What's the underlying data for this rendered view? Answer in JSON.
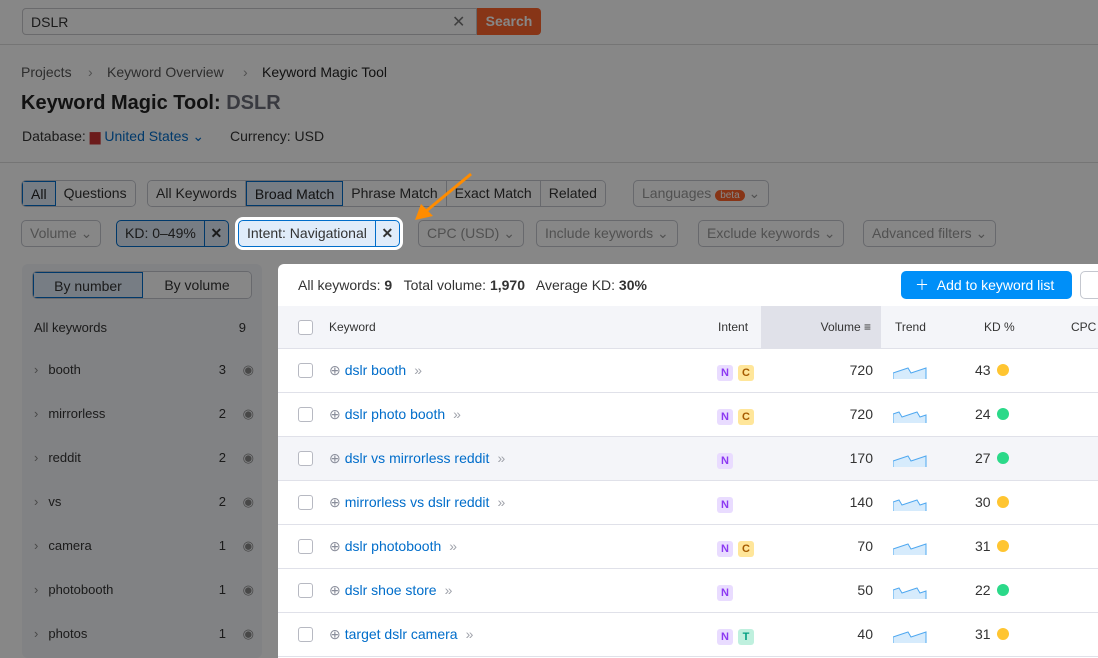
{
  "search": {
    "value": "DSLR",
    "button": "Search"
  },
  "breadcrumb": [
    "Projects",
    "Keyword Overview",
    "Keyword Magic Tool"
  ],
  "title": {
    "tool": "Keyword Magic Tool:",
    "query": "DSLR"
  },
  "database": {
    "label": "Database:",
    "value": "United States",
    "currency": "Currency: USD"
  },
  "filters": {
    "group1": [
      "All",
      "Questions"
    ],
    "group2": [
      "All Keywords",
      "Broad Match",
      "Phrase Match",
      "Exact Match",
      "Related"
    ],
    "languages": "Languages",
    "beta": "beta",
    "volume": "Volume",
    "kd": "KD: 0–49%",
    "intent": "Intent: Navigational",
    "cpc": "CPC (USD)",
    "include": "Include keywords",
    "exclude": "Exclude keywords",
    "advanced": "Advanced filters"
  },
  "sidebar": {
    "tabs": [
      "By number",
      "By volume"
    ],
    "all_label": "All keywords",
    "all_count": "9",
    "items": [
      {
        "label": "booth",
        "count": "3"
      },
      {
        "label": "mirrorless",
        "count": "2"
      },
      {
        "label": "reddit",
        "count": "2"
      },
      {
        "label": "vs",
        "count": "2"
      },
      {
        "label": "camera",
        "count": "1"
      },
      {
        "label": "photobooth",
        "count": "1"
      },
      {
        "label": "photos",
        "count": "1"
      }
    ]
  },
  "summary": {
    "all_label": "All keywords:",
    "all": "9",
    "vol_label": "Total volume:",
    "vol": "1,970",
    "kd_label": "Average KD:",
    "kd": "30%"
  },
  "add_button": "Add to keyword list",
  "columns": [
    "Keyword",
    "Intent",
    "Volume",
    "Trend",
    "KD %",
    "CPC"
  ],
  "rows": [
    {
      "keyword": "dslr booth",
      "intent": [
        "N",
        "C"
      ],
      "volume": "720",
      "kd": "43",
      "kd_color": "#ffc531"
    },
    {
      "keyword": "dslr photo booth",
      "intent": [
        "N",
        "C"
      ],
      "volume": "720",
      "kd": "24",
      "kd_color": "#2bd989"
    },
    {
      "keyword": "dslr vs mirrorless reddit",
      "intent": [
        "N"
      ],
      "volume": "170",
      "kd": "27",
      "kd_color": "#2bd989"
    },
    {
      "keyword": "mirrorless vs dslr reddit",
      "intent": [
        "N"
      ],
      "volume": "140",
      "kd": "30",
      "kd_color": "#ffc531"
    },
    {
      "keyword": "dslr photobooth",
      "intent": [
        "N",
        "C"
      ],
      "volume": "70",
      "kd": "31",
      "kd_color": "#ffc531"
    },
    {
      "keyword": "dslr shoe store",
      "intent": [
        "N"
      ],
      "volume": "50",
      "kd": "22",
      "kd_color": "#2bd989"
    },
    {
      "keyword": "target dslr camera",
      "intent": [
        "N",
        "T"
      ],
      "volume": "40",
      "kd": "31",
      "kd_color": "#ffc531"
    }
  ],
  "colors": {
    "accent": "#006dca",
    "search": "#ff642d",
    "add": "#008ff8",
    "arrow": "#ff8c00"
  }
}
